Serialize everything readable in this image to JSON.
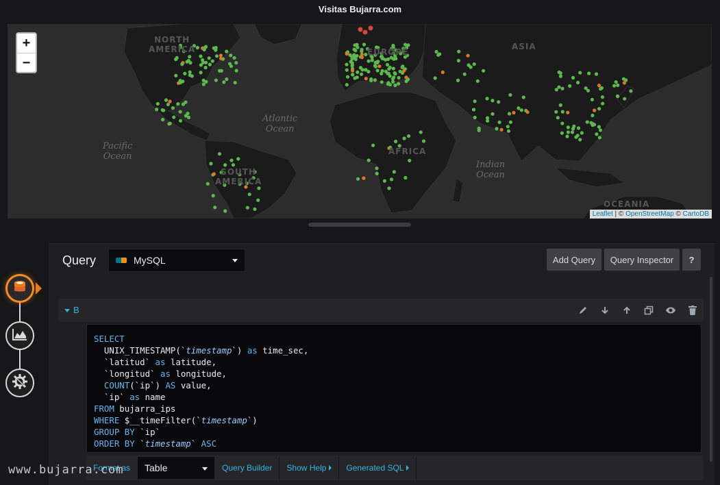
{
  "panel": {
    "title": "Visitas Bujarra.com"
  },
  "map": {
    "zoom_in": "+",
    "zoom_out": "−",
    "continents": [
      "NORTH\nAMERICA",
      "EUROPE",
      "ASIA",
      "SOUTH\nAMERICA",
      "AFRICA",
      "OCEANIA"
    ],
    "oceans": [
      "Atlantic\nOcean",
      "Pacific\nOcean",
      "Indian\nOcean"
    ],
    "attribution": {
      "leaflet": "Leaflet",
      "sep1": " | © ",
      "osm": "OpenStreetMap",
      "sep2": " © ",
      "carto": "CartoDB"
    },
    "colors": {
      "low": "#5db94e",
      "mid": "#e0752d",
      "high": "#d44a3a"
    }
  },
  "query_editor": {
    "title": "Query",
    "datasource": "MySQL",
    "add_query": "Add Query",
    "query_inspector": "Query Inspector",
    "help": "?",
    "ref_id": "B",
    "row_icons": [
      "pencil-icon",
      "arrow-down-icon",
      "arrow-up-icon",
      "duplicate-icon",
      "eye-icon",
      "trash-icon"
    ],
    "sql": {
      "l1": "SELECT",
      "l2a": "  UNIX_TIMESTAMP(`",
      "l2b": "timestamp",
      "l2c": "`) ",
      "l2d": "as",
      "l2e": " time_sec,",
      "l3a": "  `latitud` ",
      "l3b": "as",
      "l3c": " latitude,",
      "l4a": "  `longitud` ",
      "l4b": "as",
      "l4c": " longitude,",
      "l5a": "  COUNT",
      "l5b": "(`ip`) ",
      "l5c": "AS",
      "l5d": " value,",
      "l6a": "  `ip` ",
      "l6b": "as",
      "l6c": " name",
      "l7a": "FROM",
      "l7b": " bujarra_ips",
      "l8a": "WHERE",
      "l8b": " $__timeFilter(`",
      "l8c": "timestamp",
      "l8d": "`)",
      "l9a": "GROUP BY",
      "l9b": " `ip`",
      "l10a": "ORDER BY",
      "l10b": " `",
      "l10c": "timestamp",
      "l10d": "` ",
      "l10e": "ASC"
    },
    "format_as_label": "Format as",
    "format_value": "Table",
    "query_builder": "Query Builder",
    "show_help": "Show Help",
    "generated_sql": "Generated SQL"
  },
  "watermark": "www.bujarra.com"
}
